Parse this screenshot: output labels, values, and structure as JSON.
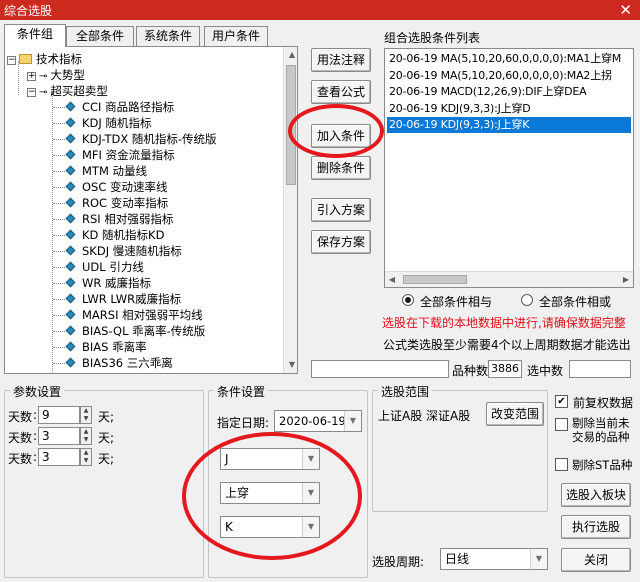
{
  "window": {
    "title": "综合选股",
    "close_icon": "close-icon"
  },
  "tabs": [
    {
      "label": "条件组",
      "active": true
    },
    {
      "label": "全部条件",
      "active": false
    },
    {
      "label": "系统条件",
      "active": false
    },
    {
      "label": "用户条件",
      "active": false
    }
  ],
  "tree": {
    "root": "技术指标",
    "groups": [
      {
        "label": "大势型",
        "expanded": false
      },
      {
        "label": "超买超卖型",
        "expanded": true
      }
    ],
    "items": [
      "CCI 商品路径指标",
      "KDJ 随机指标",
      "KDJ-TDX 随机指标-传统版",
      "MFI 资金流量指标",
      "MTM 动量线",
      "OSC 变动速率线",
      "ROC 变动率指标",
      "RSI 相对强弱指标",
      "KD 随机指标KD",
      "SKDJ 慢速随机指标",
      "UDL 引力线",
      "WR 威廉指标",
      "LWR LWR威廉指标",
      "MARSI 相对强弱平均线",
      "BIAS-QL 乖离率-传统版",
      "BIAS 乖离率",
      "BIAS36 三六乖离"
    ]
  },
  "actions": {
    "usage": "用法注释",
    "view_formula": "查看公式",
    "add_condition": "加入条件",
    "delete_condition": "删除条件",
    "import_plan": "引入方案",
    "save_plan": "保存方案"
  },
  "condition_list": {
    "title": "组合选股条件列表",
    "items": [
      {
        "text": "20-06-19 MA(5,10,20,60,0,0,0,0):MA1上穿M",
        "selected": false
      },
      {
        "text": "20-06-19 MA(5,10,20,60,0,0,0,0):MA2上拐",
        "selected": false
      },
      {
        "text": "20-06-19 MACD(12,26,9):DIF上穿DEA",
        "selected": false
      },
      {
        "text": "20-06-19 KDJ(9,3,3):J上穿D",
        "selected": false
      },
      {
        "text": "20-06-19 KDJ(9,3,3):J上穿K",
        "selected": true
      }
    ]
  },
  "logic": {
    "and_label": "全部条件相与",
    "or_label": "全部条件相或",
    "selected": "and"
  },
  "notes": {
    "warning": "选股在下载的本地数据中进行,请确保数据完整",
    "info": "公式类选股至少需要4个以上周期数据才能选出",
    "warning_color": "#e0101a"
  },
  "counts": {
    "stock_count_label": "品种数",
    "stock_count_value": "3886",
    "selected_label": "选中数",
    "selected_value": ""
  },
  "params": {
    "title": "参数设置",
    "rows": [
      {
        "label": "天数",
        "value": "9",
        "unit": "天;"
      },
      {
        "label": "天数",
        "value": "3",
        "unit": "天;"
      },
      {
        "label": "天数",
        "value": "3",
        "unit": "天;"
      }
    ]
  },
  "condition_settings": {
    "title": "条件设置",
    "date_label": "指定日期:",
    "date_value": "2020-06-19",
    "line1": "J",
    "op": "上穿",
    "line2": "K"
  },
  "scope": {
    "title": "选股范围",
    "text": "上证A股 深证A股",
    "change_btn": "改变范围"
  },
  "options": {
    "pre_adjust": {
      "label": "前复权数据",
      "checked": true
    },
    "exclude_suspended": {
      "label": "剔除当前未交易的品种",
      "checked": false
    },
    "exclude_st": {
      "label": "剔除ST品种",
      "checked": false
    }
  },
  "buttons": {
    "to_sector": "选股入板块",
    "run": "执行选股",
    "close": "关闭"
  },
  "period": {
    "label": "选股周期:",
    "value": "日线"
  }
}
